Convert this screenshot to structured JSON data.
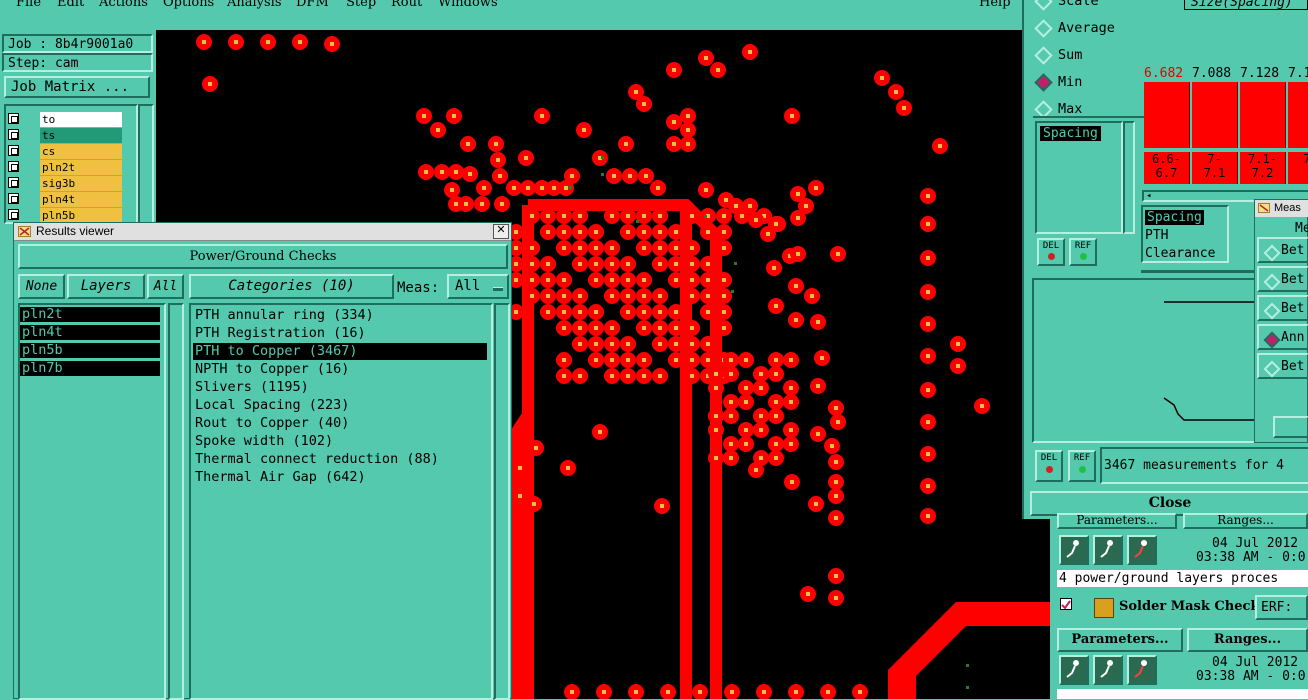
{
  "menubar": {
    "items": [
      "File",
      "Edit",
      "Actions",
      "Options",
      "Analysis",
      "DFM",
      "Step",
      "Rout",
      "Windows"
    ],
    "help": "Help"
  },
  "job_panel": {
    "job_label": "Job : 8b4r9001a0",
    "step_label": "Step: cam",
    "job_matrix_button": "Job Matrix ..."
  },
  "layers": [
    {
      "name": "to",
      "color": "#ffffff"
    },
    {
      "name": "ts",
      "color": "#229977"
    },
    {
      "name": "cs",
      "color": "#f0c040"
    },
    {
      "name": "pln2t",
      "color": "#f0c040"
    },
    {
      "name": "sig3b",
      "color": "#f0c040"
    },
    {
      "name": "pln4t",
      "color": "#f0c040"
    },
    {
      "name": "pln5b",
      "color": "#f0c040"
    }
  ],
  "results_viewer": {
    "title": "Results viewer",
    "header_button": "Power/Ground Checks",
    "none_button": "None",
    "layers_button": "Layers",
    "all_button": "All",
    "categories_button": "Categories (10)",
    "meas_label": "Meas:",
    "meas_value": "All",
    "layer_list": [
      "pln2t",
      "pln4t",
      "pln5b",
      "pln7b"
    ],
    "categories": [
      "PTH annular ring (334)",
      "PTH Registration (16)",
      "PTH to Copper (3467)",
      "NPTH to Copper (16)",
      "Slivers (1195)",
      "Local Spacing (223)",
      "Rout to Copper (40)",
      "Spoke width (102)",
      "Thermal connect reduction (88)",
      "Thermal Air Gap (642)"
    ],
    "selected_category_index": 2
  },
  "stats_panel": {
    "radio_options": [
      "Scale",
      "Average",
      "Sum",
      "Min",
      "Max"
    ],
    "selected": "Min",
    "list_items": [
      "Spacing"
    ],
    "del_label": "DEL",
    "ref_label": "REF",
    "size_label": "Size(Spacing)",
    "bar_values": [
      "6.682",
      "7.088",
      "7.128",
      "7.1"
    ],
    "bar_ranges": [
      [
        "6.6-",
        "6.7"
      ],
      [
        "7-",
        "7.1"
      ],
      [
        "7.1-",
        "7.2"
      ],
      [
        "7.",
        ""
      ]
    ],
    "meas_types": [
      "Spacing",
      "PTH",
      "Clearance"
    ],
    "measurements_text": "3467 measurements for 4",
    "close_label": "Close"
  },
  "meas_window": {
    "title": "Meas",
    "header": "Me",
    "options": [
      "Bet",
      "Bet",
      "Bet",
      "Ann",
      "Bet"
    ],
    "selected_index": 3
  },
  "checklist": {
    "parameters_label": "Parameters...",
    "ranges_label": "Ranges...",
    "date1": "04 Jul 2012",
    "time1": "03:38 AM - 0:0",
    "status1": "4 power/ground layers proces",
    "solder_mask_label": "Solder Mask Checks",
    "erf_label": "ERF:",
    "date2": "04 Jul 2012",
    "time2": "03:38 AM - 0:0"
  },
  "colors": {
    "background": "#54c9ad",
    "canvas": "#000000",
    "pad": "#ff0000",
    "pad_center": "#f0c040"
  }
}
